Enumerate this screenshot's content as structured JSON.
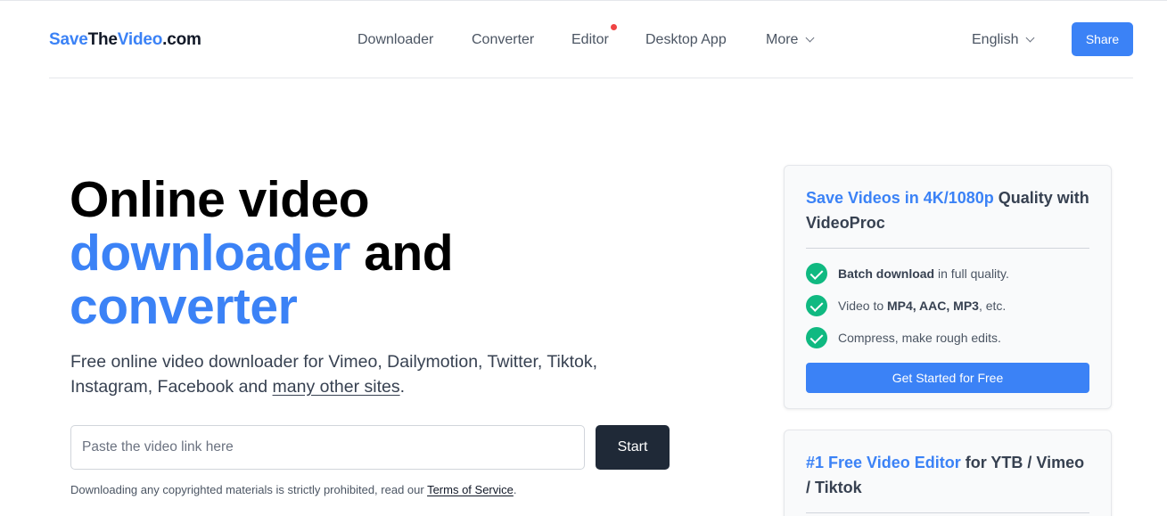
{
  "logo": {
    "part1": "Save",
    "part2": "The",
    "part3": "Video",
    "part4": ".com"
  },
  "nav": {
    "downloader": "Downloader",
    "converter": "Converter",
    "editor": "Editor",
    "desktop_app": "Desktop App",
    "more": "More"
  },
  "language": "English",
  "share_label": "Share",
  "hero": {
    "line1": "Online video",
    "line2_blue": "downloader",
    "line2_rest": " and",
    "line3_blue": "converter",
    "desc_main": "Free online video downloader for Vimeo, Dailymotion, Twitter, Tiktok, Instagram, Facebook and ",
    "desc_link": "many other sites",
    "desc_end": ".",
    "input_placeholder": "Paste the video link here",
    "start_label": "Start",
    "disclaimer_main": "Downloading any copyrighted materials is strictly prohibited, read our ",
    "disclaimer_link": "Terms of Service",
    "disclaimer_end": "."
  },
  "card1": {
    "title_blue": "Save Videos in 4K/1080p",
    "title_rest": " Quality with VideoProc",
    "features": [
      {
        "bold": "Batch download",
        "rest": " in full quality."
      },
      {
        "pre": "Video to ",
        "bold": "MP4, AAC, MP3",
        "rest": ", etc."
      },
      {
        "rest": "Compress, make rough edits."
      }
    ],
    "cta_label": "Get Started for Free"
  },
  "card2": {
    "title_blue": "#1 Free Video Editor",
    "title_rest": " for YTB / Vimeo / Tiktok"
  },
  "colors": {
    "accent": "#3b82f6",
    "dark_button": "#1f2937",
    "check_green": "#10b981",
    "notification_dot": "#ef4444"
  },
  "icons": {
    "dropdown": "chevron-down-icon",
    "feature": "check-circle-icon"
  }
}
